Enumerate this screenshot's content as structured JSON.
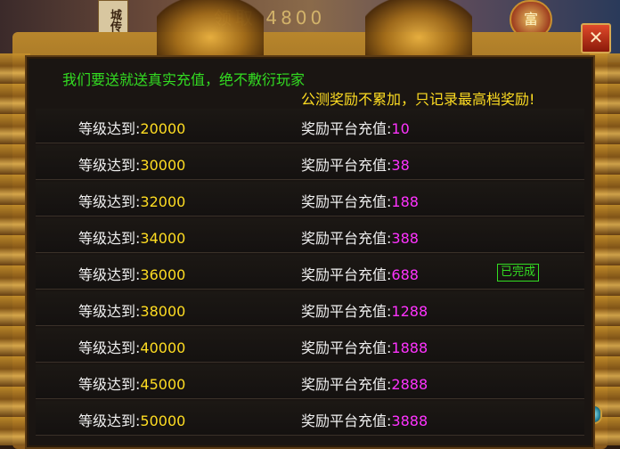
{
  "backdrop": {
    "tag_text": "城传",
    "banner_text": "领取  4800",
    "avatar_text": "富"
  },
  "dialog": {
    "close_label": "✕",
    "headline": "我们要送就送真实充值，绝不敷衍玩家",
    "note": "公测奖励不累加，只记录最高档奖励!",
    "level_label": "等级达到:",
    "reward_label": "奖励平台充值:",
    "completed_badge": "已完成",
    "rows": [
      {
        "level": "20000",
        "reward": "10",
        "completed": false
      },
      {
        "level": "30000",
        "reward": "38",
        "completed": false
      },
      {
        "level": "32000",
        "reward": "188",
        "completed": false
      },
      {
        "level": "34000",
        "reward": "388",
        "completed": false
      },
      {
        "level": "36000",
        "reward": "688",
        "completed": true
      },
      {
        "level": "38000",
        "reward": "1288",
        "completed": false
      },
      {
        "level": "40000",
        "reward": "1888",
        "completed": false
      },
      {
        "level": "45000",
        "reward": "2888",
        "completed": false
      },
      {
        "level": "50000",
        "reward": "3888",
        "completed": false
      }
    ]
  },
  "colors": {
    "headline": "#33dd22",
    "note": "#ffdd22",
    "level_value": "#ffdd22",
    "reward_value": "#ff33ff"
  }
}
